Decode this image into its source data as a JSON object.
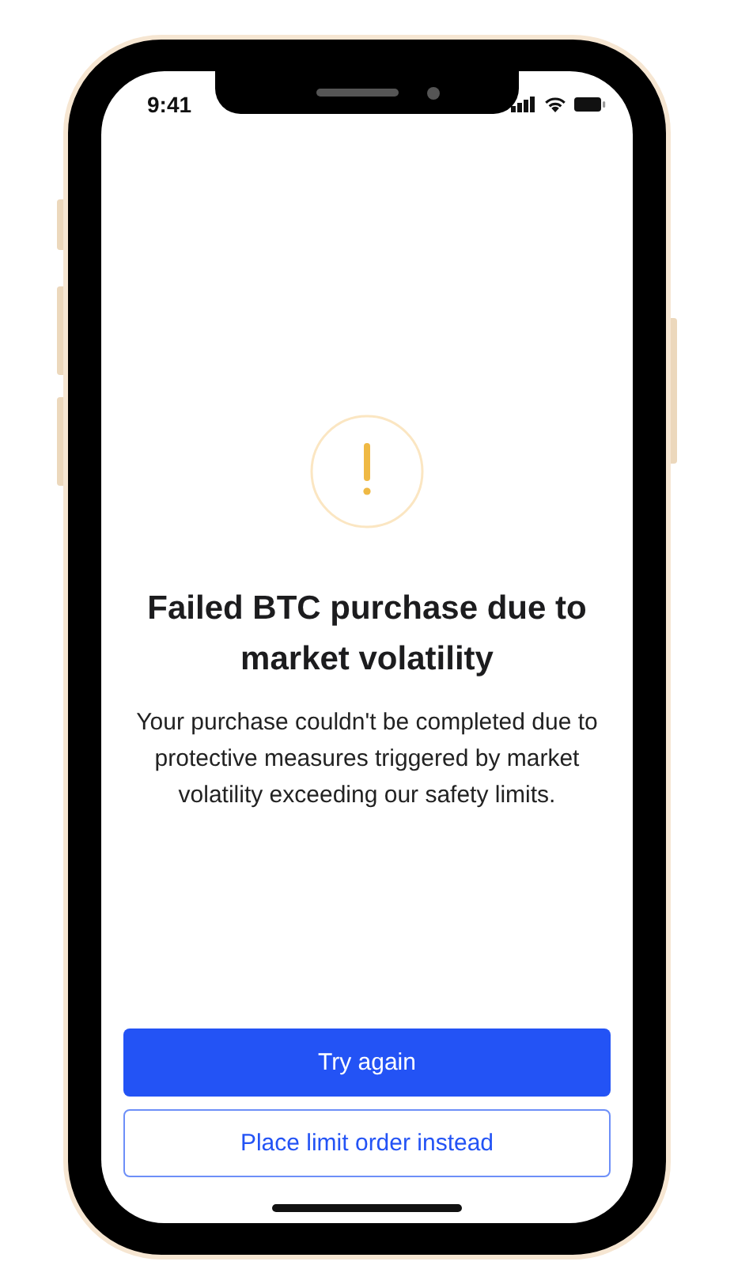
{
  "status_bar": {
    "time": "9:41"
  },
  "alert": {
    "title": "Failed BTC purchase due to market volatility",
    "message": "Your purchase couldn't be completed due to protective measures triggered by market volatility exceeding our safety limits."
  },
  "buttons": [
    {
      "label": "Try again",
      "kind": "primary"
    },
    {
      "label": "Place limit order instead",
      "kind": "secondary"
    }
  ]
}
